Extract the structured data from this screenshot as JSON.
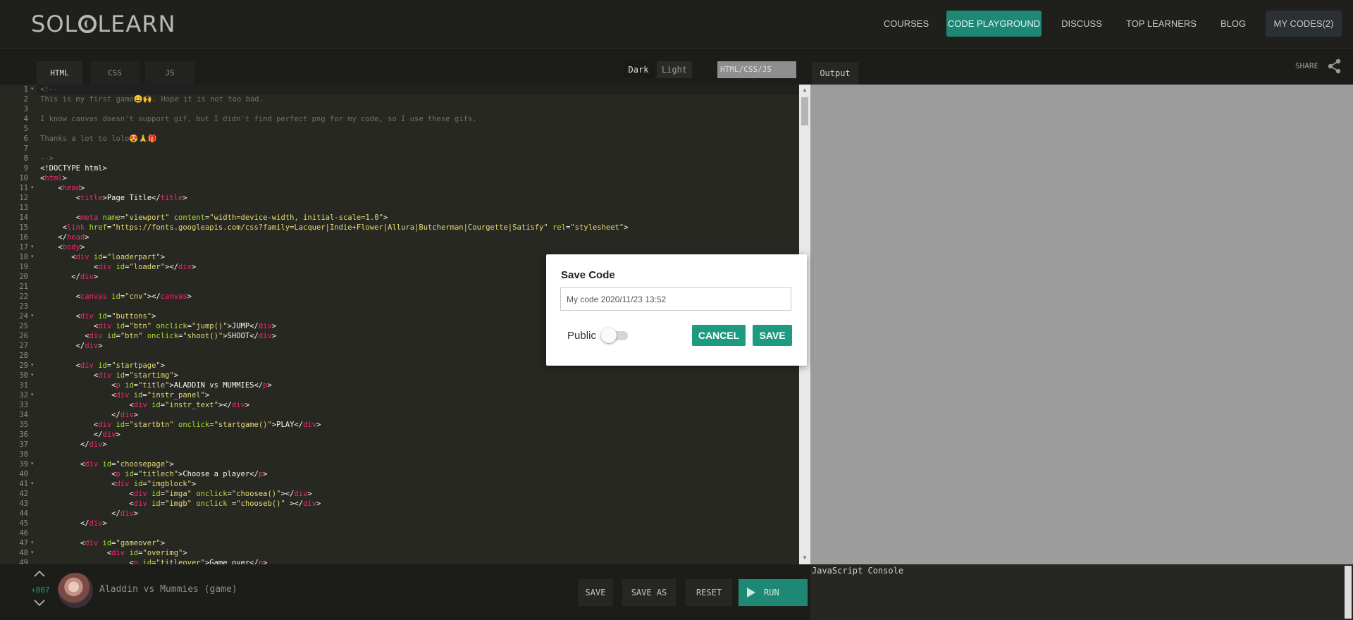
{
  "nav": {
    "logo": "SOLOLEARN",
    "logo_left": "SOL",
    "logo_right": "LEARN",
    "items": [
      "COURSES",
      "CODE PLAYGROUND",
      "DISCUSS",
      "TOP LEARNERS",
      "BLOG",
      "MY CODES(2)"
    ],
    "active": "CODE PLAYGROUND",
    "accent": "#1d8975"
  },
  "editor": {
    "tabs": [
      "HTML",
      "CSS",
      "JS"
    ],
    "active_tab": "HTML",
    "theme_options": [
      "Dark",
      "Light"
    ],
    "active_theme": "Dark",
    "language": "HTML/CSS/JS",
    "output_tab": "Output",
    "share_label": "SHARE",
    "share_icon": "share-icon",
    "line_numbers": [
      "1",
      "2",
      "3",
      "4",
      "5",
      "6",
      "7",
      "8",
      "9",
      "10",
      "11",
      "12",
      "13",
      "14",
      "15",
      "16",
      "17",
      "18",
      "19",
      "20",
      "21",
      "22",
      "23",
      "24",
      "25",
      "26",
      "27",
      "28",
      "29",
      "30",
      "31",
      "32",
      "33",
      "34",
      "35",
      "36",
      "37",
      "38",
      "39",
      "40",
      "41",
      "42",
      "43",
      "44",
      "45",
      "46",
      "47",
      "48",
      "49"
    ]
  },
  "bottom": {
    "vote_up_icon": "chevron-up-icon",
    "vote_down_icon": "chevron-down-icon",
    "votes": "+807",
    "code_name": "Aladdin vs Mummies (game)",
    "buttons": [
      "SAVE",
      "SAVE AS",
      "RESET"
    ],
    "run_label": "RUN",
    "run_icon": "play-icon",
    "console_label": "JavaScript Console"
  },
  "modal": {
    "title": "Save Code",
    "input_value": "My code 2020/11/23 13:52",
    "public_label": "Public",
    "public_toggle": false,
    "cancel_label": "CANCEL",
    "save_label": "SAVE",
    "button_color": "#1e9b7f"
  }
}
